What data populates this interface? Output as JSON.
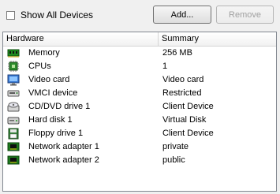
{
  "toolbar": {
    "show_all_devices_label": "Show All Devices",
    "show_all_devices_checked": false,
    "add_label": "Add...",
    "remove_label": "Remove"
  },
  "table": {
    "headers": {
      "hardware": "Hardware",
      "summary": "Summary"
    },
    "rows": [
      {
        "icon": "memory-icon",
        "hardware": "Memory",
        "summary": "256 MB"
      },
      {
        "icon": "cpu-icon",
        "hardware": "CPUs",
        "summary": "1"
      },
      {
        "icon": "video-card-icon",
        "hardware": "Video card",
        "summary": "Video card"
      },
      {
        "icon": "vmci-device-icon",
        "hardware": "VMCI device",
        "summary": "Restricted"
      },
      {
        "icon": "cd-dvd-drive-icon",
        "hardware": "CD/DVD drive 1",
        "summary": "Client Device"
      },
      {
        "icon": "hard-disk-icon",
        "hardware": "Hard disk 1",
        "summary": "Virtual Disk"
      },
      {
        "icon": "floppy-drive-icon",
        "hardware": "Floppy drive 1",
        "summary": "Client Device"
      },
      {
        "icon": "network-adapter-icon",
        "hardware": "Network adapter 1",
        "summary": "private"
      },
      {
        "icon": "network-adapter-icon",
        "hardware": "Network adapter 2",
        "summary": "public"
      }
    ]
  }
}
